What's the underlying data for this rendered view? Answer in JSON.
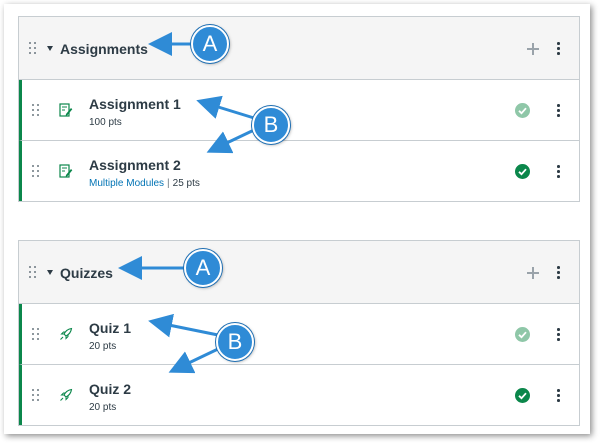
{
  "groups": [
    {
      "title": "Assignments",
      "items": [
        {
          "title": "Assignment 1",
          "meta_link": "",
          "points": "100 pts",
          "status": "light"
        },
        {
          "title": "Assignment 2",
          "meta_link": "Multiple Modules",
          "points": "25 pts",
          "status": "dark"
        }
      ]
    },
    {
      "title": "Quizzes",
      "items": [
        {
          "title": "Quiz 1",
          "meta_link": "",
          "points": "20 pts",
          "status": "light"
        },
        {
          "title": "Quiz 2",
          "meta_link": "",
          "points": "20 pts",
          "status": "dark"
        }
      ]
    }
  ],
  "meta_separator": "|",
  "callouts": {
    "a": "A",
    "b": "B"
  },
  "icons": {
    "drag": "drag-handle-icon",
    "collapse": "caret-down-icon",
    "add": "plus-icon",
    "more": "kebab-menu-icon",
    "assignment": "assignment-icon",
    "quiz": "rocket-quiz-icon",
    "published": "check-circle-icon"
  },
  "colors": {
    "accent_border": "#0b874b",
    "published": "#0b874b",
    "published_light": "#8fc7a8",
    "callout": "#2f8bd6",
    "link": "#0374b5",
    "text": "#2d3b45"
  }
}
